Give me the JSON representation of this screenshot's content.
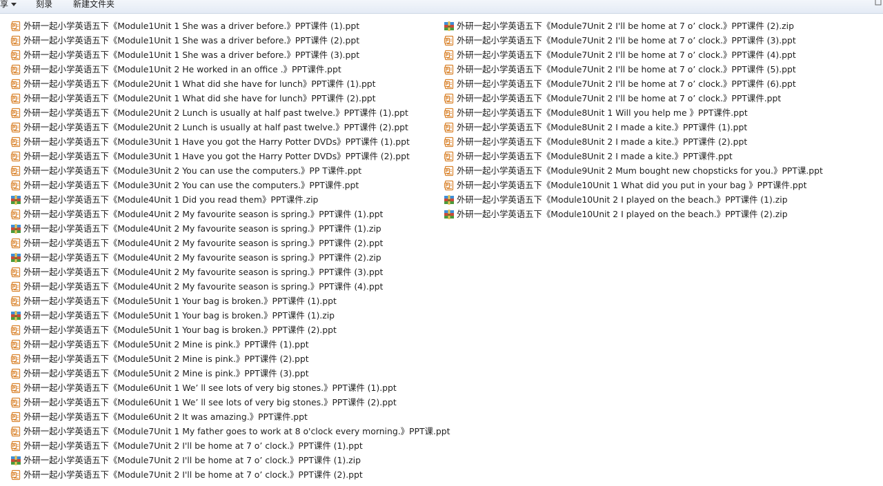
{
  "toolbar": {
    "share_label": "享",
    "burn_label": "刻录",
    "new_folder_label": "新建文件夹"
  },
  "files_left": [
    {
      "name": "外研一起小学英语五下《Module1Unit 1 She was a driver before.》PPT课件 (1).ppt",
      "icon": "ppt-file-icon"
    },
    {
      "name": "外研一起小学英语五下《Module1Unit 1 She was a driver before.》PPT课件 (2).ppt",
      "icon": "ppt-file-icon"
    },
    {
      "name": "外研一起小学英语五下《Module1Unit 1 She was a driver before.》PPT课件 (3).ppt",
      "icon": "ppt-file-icon"
    },
    {
      "name": "外研一起小学英语五下《Module1Unit 2 He worked in an office .》PPT课件.ppt",
      "icon": "ppt-file-icon"
    },
    {
      "name": "外研一起小学英语五下《Module2Unit 1 What did she have for lunch》PPT课件 (1).ppt",
      "icon": "ppt-file-icon"
    },
    {
      "name": "外研一起小学英语五下《Module2Unit 1 What did she have for lunch》PPT课件 (2).ppt",
      "icon": "ppt-file-icon"
    },
    {
      "name": "外研一起小学英语五下《Module2Unit 2 Lunch is usually at half past twelve.》PPT课件 (1).ppt",
      "icon": "ppt-file-icon"
    },
    {
      "name": "外研一起小学英语五下《Module2Unit 2 Lunch is usually at half past twelve.》PPT课件 (2).ppt",
      "icon": "ppt-file-icon"
    },
    {
      "name": "外研一起小学英语五下《Module3Unit 1 Have you got the Harry Potter DVDs》PPT课件 (1).ppt",
      "icon": "ppt-file-icon"
    },
    {
      "name": "外研一起小学英语五下《Module3Unit 1 Have you got the Harry Potter DVDs》PPT课件 (2).ppt",
      "icon": "ppt-file-icon"
    },
    {
      "name": "外研一起小学英语五下《Module3Unit 2 You can use the computers.》PP T课件.ppt",
      "icon": "ppt-file-icon"
    },
    {
      "name": "外研一起小学英语五下《Module3Unit 2 You can use the computers.》PPT课件.ppt",
      "icon": "ppt-file-icon"
    },
    {
      "name": "外研一起小学英语五下《Module4Unit 1 Did you read them》PPT课件.zip",
      "icon": "zip-archive-icon"
    },
    {
      "name": "外研一起小学英语五下《Module4Unit 2 My favourite season is spring.》PPT课件 (1).ppt",
      "icon": "ppt-file-icon"
    },
    {
      "name": "外研一起小学英语五下《Module4Unit 2 My favourite season is spring.》PPT课件 (1).zip",
      "icon": "zip-archive-icon"
    },
    {
      "name": "外研一起小学英语五下《Module4Unit 2 My favourite season is spring.》PPT课件 (2).ppt",
      "icon": "ppt-file-icon"
    },
    {
      "name": "外研一起小学英语五下《Module4Unit 2 My favourite season is spring.》PPT课件 (2).zip",
      "icon": "zip-archive-icon"
    },
    {
      "name": "外研一起小学英语五下《Module4Unit 2 My favourite season is spring.》PPT课件 (3).ppt",
      "icon": "ppt-file-icon"
    },
    {
      "name": "外研一起小学英语五下《Module4Unit 2 My favourite season is spring.》PPT课件 (4).ppt",
      "icon": "ppt-file-icon"
    },
    {
      "name": "外研一起小学英语五下《Module5Unit 1 Your bag is broken.》PPT课件 (1).ppt",
      "icon": "ppt-file-icon"
    },
    {
      "name": "外研一起小学英语五下《Module5Unit 1 Your bag is broken.》PPT课件 (1).zip",
      "icon": "zip-archive-icon"
    },
    {
      "name": "外研一起小学英语五下《Module5Unit 1 Your bag is broken.》PPT课件 (2).ppt",
      "icon": "ppt-file-icon"
    },
    {
      "name": "外研一起小学英语五下《Module5Unit 2 Mine is pink.》PPT课件 (1).ppt",
      "icon": "ppt-file-icon"
    },
    {
      "name": "外研一起小学英语五下《Module5Unit 2 Mine is pink.》PPT课件 (2).ppt",
      "icon": "ppt-file-icon"
    },
    {
      "name": "外研一起小学英语五下《Module5Unit 2 Mine is pink.》PPT课件 (3).ppt",
      "icon": "ppt-file-icon"
    },
    {
      "name": "外研一起小学英语五下《Module6Unit 1 We’ ll see lots of very big stones.》PPT课件 (1).ppt",
      "icon": "ppt-file-icon"
    },
    {
      "name": "外研一起小学英语五下《Module6Unit 1 We’ ll see lots of very big stones.》PPT课件 (2).ppt",
      "icon": "ppt-file-icon"
    },
    {
      "name": "外研一起小学英语五下《Module6Unit 2 It was amazing.》PPT课件.ppt",
      "icon": "ppt-file-icon"
    },
    {
      "name": "外研一起小学英语五下《Module7Unit 1 My father goes to work at 8 o'clock every morning.》PPT课.ppt",
      "icon": "ppt-file-icon"
    },
    {
      "name": "外研一起小学英语五下《Module7Unit 2 I'll be home at 7 o’ clock.》PPT课件 (1).ppt",
      "icon": "ppt-file-icon"
    },
    {
      "name": "外研一起小学英语五下《Module7Unit 2 I'll be home at 7 o’ clock.》PPT课件 (1).zip",
      "icon": "zip-archive-icon"
    },
    {
      "name": "外研一起小学英语五下《Module7Unit 2 I'll be home at 7 o’ clock.》PPT课件 (2).ppt",
      "icon": "ppt-file-icon"
    }
  ],
  "files_right": [
    {
      "name": "外研一起小学英语五下《Module7Unit 2 I'll be home at 7 o’ clock.》PPT课件 (2).zip",
      "icon": "zip-archive-icon"
    },
    {
      "name": "外研一起小学英语五下《Module7Unit 2 I'll be home at 7 o’ clock.》PPT课件 (3).ppt",
      "icon": "ppt-file-icon"
    },
    {
      "name": "外研一起小学英语五下《Module7Unit 2 I'll be home at 7 o’ clock.》PPT课件 (4).ppt",
      "icon": "ppt-file-icon"
    },
    {
      "name": "外研一起小学英语五下《Module7Unit 2 I'll be home at 7 o’ clock.》PPT课件 (5).ppt",
      "icon": "ppt-file-icon"
    },
    {
      "name": "外研一起小学英语五下《Module7Unit 2 I'll be home at 7 o’ clock.》PPT课件 (6).ppt",
      "icon": "ppt-file-icon"
    },
    {
      "name": "外研一起小学英语五下《Module7Unit 2 I'll be home at 7 o’ clock.》PPT课件.ppt",
      "icon": "ppt-file-icon"
    },
    {
      "name": "外研一起小学英语五下《Module8Unit 1 Will you help me 》PPT课件.ppt",
      "icon": "ppt-file-icon"
    },
    {
      "name": "外研一起小学英语五下《Module8Unit 2 I made a kite.》PPT课件 (1).ppt",
      "icon": "ppt-file-icon"
    },
    {
      "name": "外研一起小学英语五下《Module8Unit 2 I made a kite.》PPT课件 (2).ppt",
      "icon": "ppt-file-icon"
    },
    {
      "name": "外研一起小学英语五下《Module8Unit 2 I made a kite.》PPT课件.ppt",
      "icon": "ppt-file-icon"
    },
    {
      "name": "外研一起小学英语五下《Module9Unit 2 Mum bought new chopsticks for you.》PPT课.ppt",
      "icon": "ppt-file-icon"
    },
    {
      "name": "外研一起小学英语五下《Module10Unit 1 What did you put in your bag 》PPT课件.ppt",
      "icon": "ppt-file-icon"
    },
    {
      "name": "外研一起小学英语五下《Module10Unit 2 I played on the beach.》PPT课件 (1).zip",
      "icon": "zip-archive-icon"
    },
    {
      "name": "外研一起小学英语五下《Module10Unit 2 I played on the beach.》PPT课件 (2).zip",
      "icon": "zip-archive-icon"
    }
  ],
  "colors": {
    "ppt_icon": "#d9822b",
    "zip_icon_blue": "#3f8fd6",
    "zip_icon_green": "#4c9a3c",
    "toolbar_bg": "#e4ebf5"
  }
}
